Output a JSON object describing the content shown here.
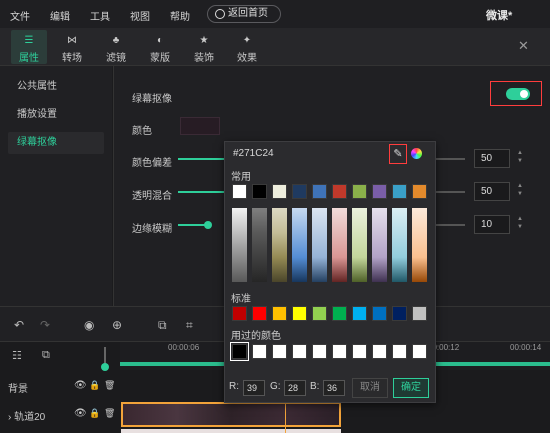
{
  "menu": [
    "文件",
    "编辑",
    "工具",
    "视图",
    "帮助"
  ],
  "home_button": "返回首页",
  "app_title": "微课*",
  "tabs": [
    {
      "icon": "sliders-icon",
      "glyph": "☰",
      "label": "属性",
      "active": true
    },
    {
      "icon": "transition-icon",
      "glyph": "⋈",
      "label": "转场",
      "active": false
    },
    {
      "icon": "filter-icon",
      "glyph": "♣",
      "label": "滤镜",
      "active": false
    },
    {
      "icon": "mask-icon",
      "glyph": "◐",
      "label": "蒙版",
      "active": false
    },
    {
      "icon": "decoration-icon",
      "glyph": "★",
      "label": "装饰",
      "active": false
    },
    {
      "icon": "effect-icon",
      "glyph": "✦",
      "label": "效果",
      "active": false
    }
  ],
  "close": "✕",
  "sidenav": [
    "公共属性",
    "播放设置",
    "绿幕抠像"
  ],
  "panel": {
    "chroma_label": "绿幕抠像",
    "chroma_enabled": true,
    "color_label": "颜色",
    "color_value": "#271C24",
    "sliders": [
      {
        "label": "颜色偏差",
        "value": "50"
      },
      {
        "label": "透明混合",
        "value": "50"
      },
      {
        "label": "边缘模糊",
        "value": "10"
      }
    ]
  },
  "colorpicker": {
    "hex": "#271C24",
    "common_label": "常用",
    "standard_label": "标准",
    "used_label": "用过的颜色",
    "common_top": [
      "#ffffff",
      "#000000",
      "#eeeedd",
      "#1f3a60",
      "#3f73b8",
      "#c0392b",
      "#8ab04a",
      "#7a5ea8",
      "#3aa0c8",
      "#e38a2c"
    ],
    "grad_cols": [
      [
        "#f2f2f2",
        "#bfbfbf",
        "#8c8c8c",
        "#595959"
      ],
      [
        "#7f7f7f",
        "#595959",
        "#3f3f3f",
        "#262626"
      ],
      [
        "#ddd9c3",
        "#c4bd97",
        "#948a54",
        "#4a452a"
      ],
      [
        "#c6d9f0",
        "#8db3e2",
        "#548dd4",
        "#17365d"
      ],
      [
        "#dbe5f1",
        "#b8cce4",
        "#95b3d7",
        "#244061"
      ],
      [
        "#f2dcdb",
        "#e5b9b7",
        "#d99694",
        "#632423"
      ],
      [
        "#ebf1dd",
        "#d7e3bc",
        "#c3d69b",
        "#4f6128"
      ],
      [
        "#e5e0ec",
        "#ccc1d9",
        "#b2a2c7",
        "#3f3151"
      ],
      [
        "#dbeef3",
        "#b7dde8",
        "#92cddc",
        "#205867"
      ],
      [
        "#fdeada",
        "#fbd5b5",
        "#fac08f",
        "#974806"
      ]
    ],
    "standard": [
      "#c00000",
      "#ff0000",
      "#ffc000",
      "#ffff00",
      "#92d050",
      "#00b050",
      "#00b0f0",
      "#0070c0",
      "#002060",
      "#c0c0c0"
    ],
    "used": [
      "#000000",
      "#ffffff",
      "#ffffff",
      "#ffffff",
      "#ffffff",
      "#ffffff",
      "#ffffff",
      "#ffffff",
      "#ffffff",
      "#ffffff"
    ],
    "r_label": "R:",
    "r": "39",
    "g_label": "G:",
    "g": "28",
    "b_label": "B:",
    "b": "36",
    "cancel": "取消",
    "ok": "确定"
  },
  "timeline": {
    "ticks": [
      "00:00:06",
      "00:00:12",
      "00:00:14"
    ],
    "tracks": [
      {
        "label": "背景"
      },
      {
        "label": "轨道20"
      }
    ]
  }
}
